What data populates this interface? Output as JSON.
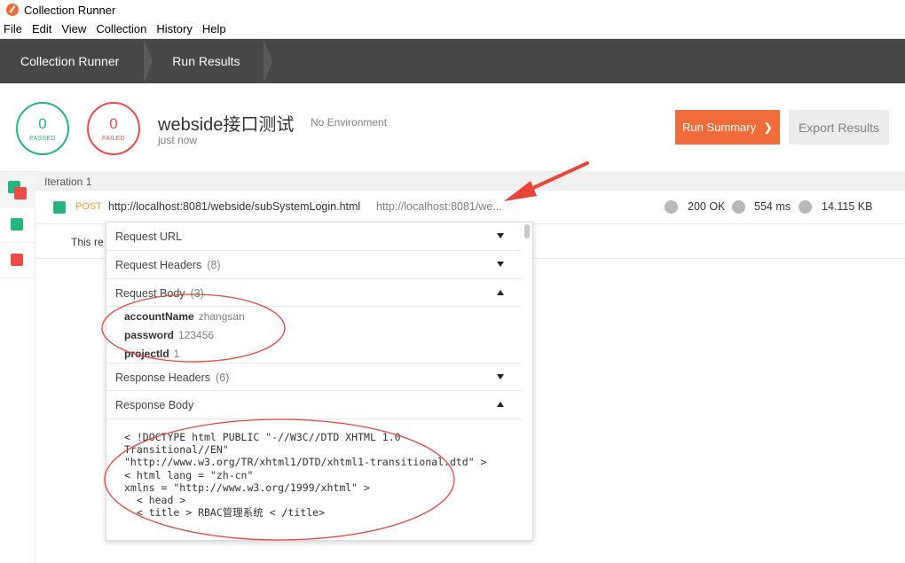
{
  "window": {
    "title": "Collection Runner"
  },
  "menu": [
    "File",
    "Edit",
    "View",
    "Collection",
    "History",
    "Help"
  ],
  "breadcrumbs": [
    "Collection Runner",
    "Run Results"
  ],
  "summary": {
    "passed_count": "0",
    "passed_label": "PASSED",
    "failed_count": "0",
    "failed_label": "FAILED",
    "collection_name": "webside接口测试",
    "environment": "No Environment",
    "time": "just now",
    "run_summary_label": "Run Summary",
    "export_label": "Export Results"
  },
  "iteration": {
    "label": "Iteration 1"
  },
  "request": {
    "method": "POST",
    "name": "http://localhost:8081/webside/subSystemLogin.html",
    "url": "http://localhost:8081/we...",
    "status": "200 OK",
    "time": "554 ms",
    "size": "14.115 KB"
  },
  "test_row": {
    "text": "This re"
  },
  "details": {
    "request_url": {
      "title": "Request URL"
    },
    "request_headers": {
      "title": "Request Headers",
      "count": "(8)"
    },
    "request_body": {
      "title": "Request Body",
      "count": "(3)",
      "params": [
        {
          "key": "accountName",
          "value": "zhangsan"
        },
        {
          "key": "password",
          "value": "123456"
        },
        {
          "key": "projectId",
          "value": "1"
        }
      ]
    },
    "response_headers": {
      "title": "Response Headers",
      "count": "(6)"
    },
    "response_body": {
      "title": "Response Body",
      "content": "< !DOCTYPE html PUBLIC \"-//W3C//DTD XHTML 1.0\nTransitional//EN\"\n\"http://www.w3.org/TR/xhtml1/DTD/xhtml1-transitional.dtd\" >\n< html lang = \"zh-cn\"\nxmlns = \"http://www.w3.org/1999/xhtml\" >\n  < head >\n  < title > RBAC管理系统 < /title>"
    }
  },
  "colors": {
    "accent": "#f26b3a",
    "pass": "#26b47f",
    "fail": "#ed4b48",
    "annotation": "#e8453c"
  }
}
